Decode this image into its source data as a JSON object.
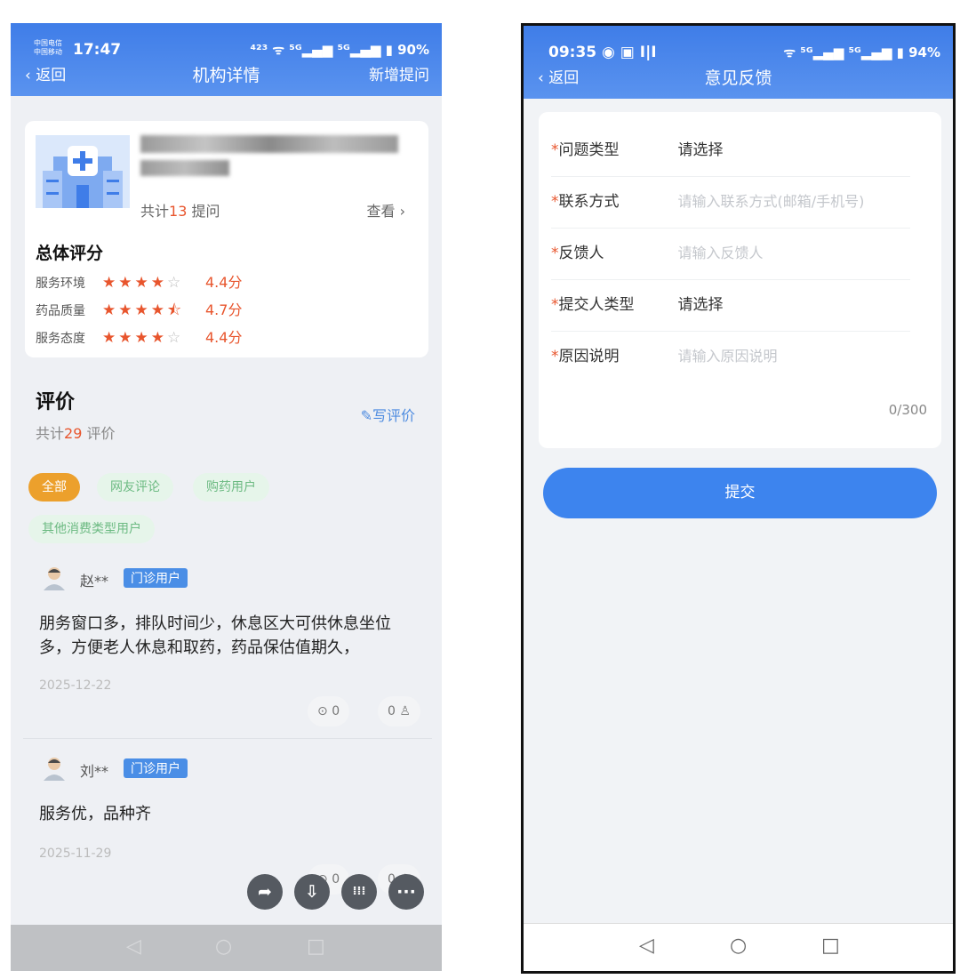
{
  "left": {
    "status": {
      "carrier": "中国电信\n中国移动",
      "time": "17:47",
      "right": "⁴²³ ᯤ ⁵ᴳ▂▄▆ ⁵ᴳ▂▄▆ ▮ 90%"
    },
    "nav": {
      "back": "返回",
      "title": "机构详情",
      "right": "新增提问"
    },
    "card": {
      "question_prefix": "共计",
      "question_count": "13",
      "question_suffix": " 提问",
      "view": "查看 ›",
      "overall_title": "总体评分",
      "ratings": [
        {
          "label": "服务环境",
          "stars_on": "★★★★",
          "stars_off": "☆",
          "score": "4.4分",
          "value": 4.4
        },
        {
          "label": "药品质量",
          "stars_on": "★★★★⯪",
          "stars_off": "",
          "score": "4.7分",
          "value": 4.7
        },
        {
          "label": "服务态度",
          "stars_on": "★★★★",
          "stars_off": "☆",
          "score": "4.4分",
          "value": 4.4
        }
      ]
    },
    "reviews": {
      "title": "评价",
      "count_prefix": "共计",
      "count": "29",
      "count_suffix": " 评价",
      "write": "✎写评价",
      "filters": [
        "全部",
        "网友评论",
        "购药用户",
        "其他消费类型用户"
      ],
      "items": [
        {
          "user": "赵**",
          "badge": "门诊用户",
          "text": "朋务窗口多，排队时间少，休息区大可供休息坐位多，方便老人休息和取药，药品保估值期久，",
          "date": "2025-12-22",
          "comments": "0",
          "likes": "0"
        },
        {
          "user": "刘**",
          "badge": "门诊用户",
          "text": "服务优，品种齐",
          "date": "2025-11-29",
          "comments": "0",
          "likes": "0"
        }
      ]
    },
    "fabs": {
      "share": "➦",
      "save": "⇩",
      "apps": "⁞⁞⁞",
      "more": "···"
    },
    "navbar": {
      "back": "◁",
      "home": "○",
      "recent": "□"
    }
  },
  "right": {
    "status": {
      "time": "09:35 ◉ ▣ I|I",
      "right": "ᯤ ⁵ᴳ▂▄▆ ⁵ᴳ▂▄▆ ▮ 94%"
    },
    "nav": {
      "back": "返回",
      "title": "意见反馈"
    },
    "form": {
      "required_mark": "*",
      "fields": [
        {
          "label": "问题类型",
          "value": "请选择"
        },
        {
          "label": "联系方式",
          "placeholder": "请输入联系方式(邮箱/手机号)"
        },
        {
          "label": "反馈人",
          "placeholder": "请输入反馈人"
        },
        {
          "label": "提交人类型",
          "value": "请选择"
        },
        {
          "label": "原因说明",
          "placeholder": "请输入原因说明"
        }
      ],
      "counter": "0/300",
      "submit": "提交"
    },
    "navbar": {
      "back": "◁",
      "home": "○",
      "recent": "□"
    }
  }
}
